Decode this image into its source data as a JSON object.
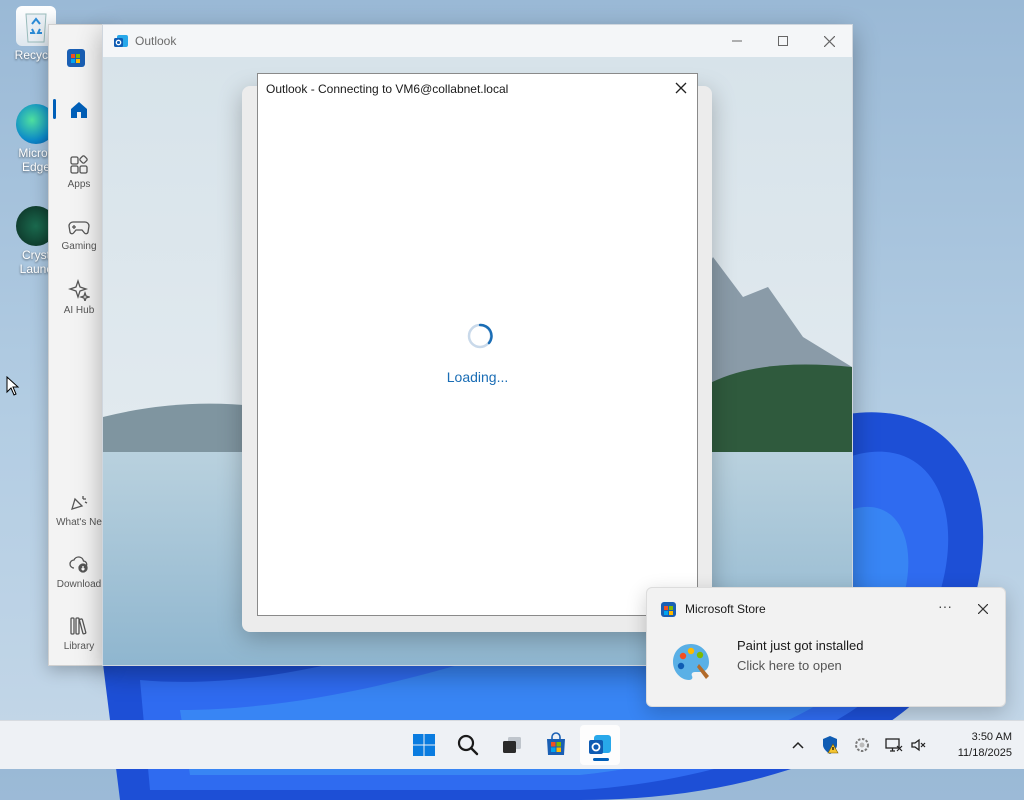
{
  "desktop": {
    "icons": [
      {
        "label": "Recycle"
      },
      {
        "label": "Micros Edge"
      },
      {
        "label": "Cryst Launc"
      }
    ]
  },
  "store_window": {
    "nav": [
      {
        "label": "Apps",
        "icon": "apps-icon"
      },
      {
        "label": "Gaming",
        "icon": "gamepad-icon"
      },
      {
        "label": "AI Hub",
        "icon": "sparkle-icon"
      },
      {
        "label": "What's Ne",
        "icon": "bell-sparkle-icon"
      },
      {
        "label": "Download",
        "icon": "cloud-download-icon"
      },
      {
        "label": "Library",
        "icon": "library-icon"
      }
    ]
  },
  "outlook_window": {
    "title": "Outlook"
  },
  "dialog": {
    "title": "Outlook - Connecting to VM6@collabnet.local",
    "loading_text": "Loading..."
  },
  "toast": {
    "app_name": "Microsoft Store",
    "more": "···",
    "title": "Paint just got installed",
    "subtitle": "Click here to open"
  },
  "taskbar": {
    "apps": [
      "start-icon",
      "search-icon",
      "task-view-icon",
      "microsoft-store-icon",
      "outlook-icon"
    ],
    "clock_time": "3:50 AM",
    "clock_date": "11/18/2025"
  },
  "colors": {
    "accent": "#005fb8",
    "loading": "#1a6db5"
  }
}
